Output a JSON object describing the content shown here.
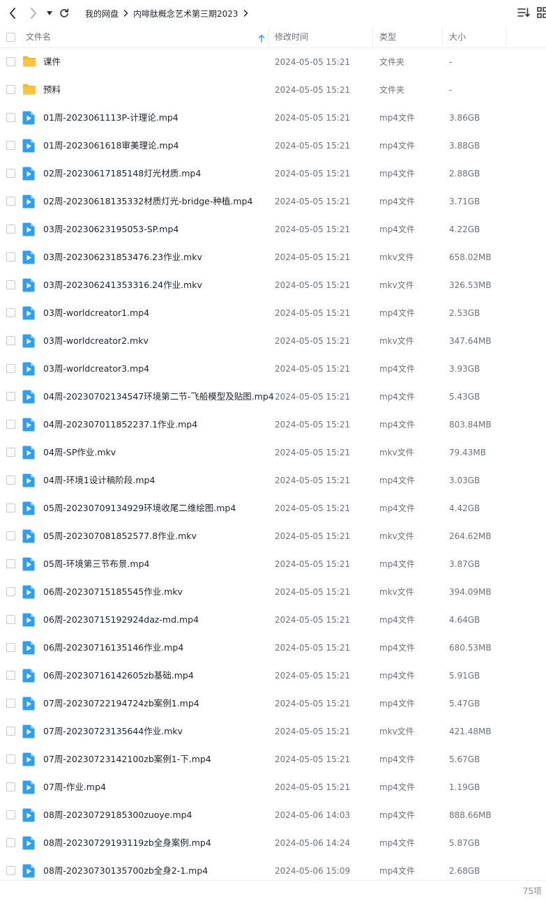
{
  "toolbar": {
    "back_icon": "chevron-left-icon",
    "forward_icon": "chevron-right-icon",
    "history_icon": "caret-down-icon",
    "refresh_icon": "refresh-icon",
    "sort_icon": "sort-list-icon",
    "view_icon": "grid-view-icon"
  },
  "breadcrumb": {
    "root": "我的网盘",
    "current": "内啡肽概念艺术第三期2023"
  },
  "columns": {
    "name": "文件名",
    "modified": "修改时间",
    "type": "类型",
    "size": "大小"
  },
  "colors": {
    "folder": "#f5b727",
    "video": "#2d9ff0",
    "text": "#1f2329",
    "muted": "#6d7178",
    "border": "#eceef2"
  },
  "files": [
    {
      "name": "课件",
      "date": "2024-05-05 15:21",
      "type": "文件夹",
      "size": "-",
      "icon": "folder-icon"
    },
    {
      "name": "预料",
      "date": "2024-05-05 15:21",
      "type": "文件夹",
      "size": "-",
      "icon": "folder-icon"
    },
    {
      "name": "01周-2023061113P-计理论.mp4",
      "date": "2024-05-05 15:21",
      "type": "mp4文件",
      "size": "3.86GB",
      "icon": "video-file-icon"
    },
    {
      "name": "01周-2023061618审美理论.mp4",
      "date": "2024-05-05 15:21",
      "type": "mp4文件",
      "size": "3.88GB",
      "icon": "video-file-icon"
    },
    {
      "name": "02周-20230617185148灯光材质.mp4",
      "date": "2024-05-05 15:21",
      "type": "mp4文件",
      "size": "2.88GB",
      "icon": "video-file-icon"
    },
    {
      "name": "02周-20230618135332材质灯光-bridge-种植.mp4",
      "date": "2024-05-05 15:21",
      "type": "mp4文件",
      "size": "3.71GB",
      "icon": "video-file-icon"
    },
    {
      "name": "03周-20230623195053-SP.mp4",
      "date": "2024-05-05 15:21",
      "type": "mp4文件",
      "size": "4.22GB",
      "icon": "video-file-icon"
    },
    {
      "name": "03周-202306231853476.23作业.mkv",
      "date": "2024-05-05 15:21",
      "type": "mkv文件",
      "size": "658.02MB",
      "icon": "video-file-icon"
    },
    {
      "name": "03周-202306241353316.24作业.mkv",
      "date": "2024-05-05 15:21",
      "type": "mkv文件",
      "size": "326.53MB",
      "icon": "video-file-icon"
    },
    {
      "name": "03周-worldcreator1.mp4",
      "date": "2024-05-05 15:21",
      "type": "mp4文件",
      "size": "2.53GB",
      "icon": "video-file-icon"
    },
    {
      "name": "03周-worldcreator2.mkv",
      "date": "2024-05-05 15:21",
      "type": "mkv文件",
      "size": "347.64MB",
      "icon": "video-file-icon"
    },
    {
      "name": "03周-worldcreator3.mp4",
      "date": "2024-05-05 15:21",
      "type": "mp4文件",
      "size": "3.93GB",
      "icon": "video-file-icon"
    },
    {
      "name": "04周-20230702134547环境第二节-飞船模型及贴图.mp4",
      "date": "2024-05-05 15:21",
      "type": "mp4文件",
      "size": "5.43GB",
      "icon": "video-file-icon"
    },
    {
      "name": "04周-202307011852237.1作业.mp4",
      "date": "2024-05-05 15:21",
      "type": "mp4文件",
      "size": "803.84MB",
      "icon": "video-file-icon"
    },
    {
      "name": "04周-SP作业.mkv",
      "date": "2024-05-05 15:21",
      "type": "mkv文件",
      "size": "79.43MB",
      "icon": "video-file-icon"
    },
    {
      "name": "04周-环境1设计稿阶段.mp4",
      "date": "2024-05-05 15:21",
      "type": "mp4文件",
      "size": "3.03GB",
      "icon": "video-file-icon"
    },
    {
      "name": "05周-20230709134929环境收尾二维绘图.mp4",
      "date": "2024-05-05 15:21",
      "type": "mp4文件",
      "size": "4.42GB",
      "icon": "video-file-icon"
    },
    {
      "name": "05周-202307081852577.8作业.mkv",
      "date": "2024-05-05 15:21",
      "type": "mkv文件",
      "size": "264.62MB",
      "icon": "video-file-icon"
    },
    {
      "name": "05周-环境第三节布景.mp4",
      "date": "2024-05-05 15:21",
      "type": "mp4文件",
      "size": "3.87GB",
      "icon": "video-file-icon"
    },
    {
      "name": "06周-20230715185545作业.mkv",
      "date": "2024-05-05 15:21",
      "type": "mkv文件",
      "size": "394.09MB",
      "icon": "video-file-icon"
    },
    {
      "name": "06周-20230715192924daz-md.mp4",
      "date": "2024-05-05 15:21",
      "type": "mp4文件",
      "size": "4.64GB",
      "icon": "video-file-icon"
    },
    {
      "name": "06周-20230716135146作业.mp4",
      "date": "2024-05-05 15:21",
      "type": "mp4文件",
      "size": "680.53MB",
      "icon": "video-file-icon"
    },
    {
      "name": "06周-20230716142605zb基础.mp4",
      "date": "2024-05-05 15:21",
      "type": "mp4文件",
      "size": "5.91GB",
      "icon": "video-file-icon"
    },
    {
      "name": "07周-20230722194724zb案例1.mp4",
      "date": "2024-05-05 15:21",
      "type": "mp4文件",
      "size": "5.47GB",
      "icon": "video-file-icon"
    },
    {
      "name": "07周-20230723135644作业.mkv",
      "date": "2024-05-05 15:21",
      "type": "mkv文件",
      "size": "421.48MB",
      "icon": "video-file-icon"
    },
    {
      "name": "07周-20230723142100zb案例1-下.mp4",
      "date": "2024-05-05 15:21",
      "type": "mp4文件",
      "size": "5.67GB",
      "icon": "video-file-icon"
    },
    {
      "name": "07周-作业.mp4",
      "date": "2024-05-05 15:21",
      "type": "mp4文件",
      "size": "1.19GB",
      "icon": "video-file-icon"
    },
    {
      "name": "08周-20230729185300zuoye.mp4",
      "date": "2024-05-06 14:03",
      "type": "mp4文件",
      "size": "888.66MB",
      "icon": "video-file-icon"
    },
    {
      "name": "08周-20230729193119zb全身案例.mp4",
      "date": "2024-05-06 14:24",
      "type": "mp4文件",
      "size": "5.87GB",
      "icon": "video-file-icon"
    },
    {
      "name": "08周-20230730135700zb全身2-1.mp4",
      "date": "2024-05-06 15:09",
      "type": "mp4文件",
      "size": "2.68GB",
      "icon": "video-file-icon"
    }
  ],
  "footer": {
    "item_count": "75项"
  }
}
